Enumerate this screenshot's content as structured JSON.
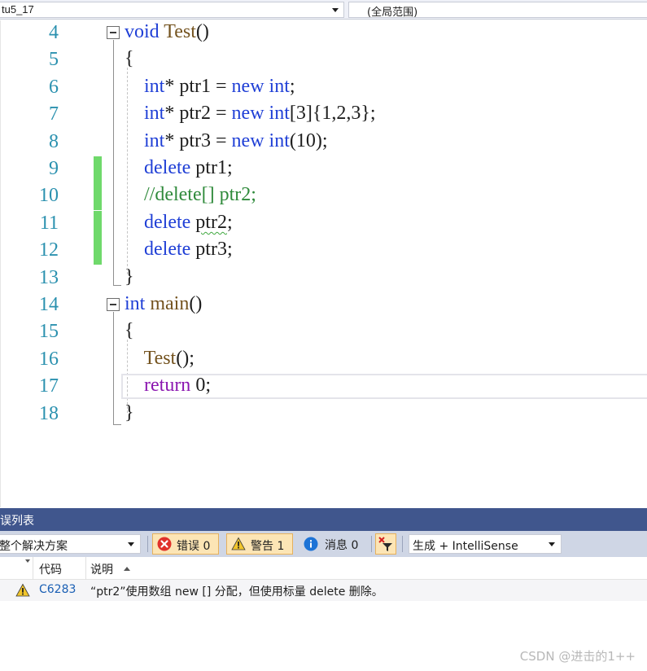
{
  "navbar": {
    "project_scope": "tu5_17",
    "member_scope": "(全局范围)"
  },
  "editor": {
    "lines": [
      {
        "num": "4",
        "tokens": [
          {
            "t": "void",
            "c": "kw"
          },
          {
            "t": " ",
            "c": "pl"
          },
          {
            "t": "Test",
            "c": "fn"
          },
          {
            "t": "()",
            "c": "pl"
          }
        ]
      },
      {
        "num": "5",
        "tokens": [
          {
            "t": "{",
            "c": "pl"
          }
        ]
      },
      {
        "num": "6",
        "tokens": [
          {
            "t": "    ",
            "c": "pl"
          },
          {
            "t": "int",
            "c": "kw"
          },
          {
            "t": "* ptr1 = ",
            "c": "pl"
          },
          {
            "t": "new",
            "c": "kw"
          },
          {
            "t": " ",
            "c": "pl"
          },
          {
            "t": "int",
            "c": "kw"
          },
          {
            "t": ";",
            "c": "pl"
          }
        ]
      },
      {
        "num": "7",
        "tokens": [
          {
            "t": "    ",
            "c": "pl"
          },
          {
            "t": "int",
            "c": "kw"
          },
          {
            "t": "* ptr2 = ",
            "c": "pl"
          },
          {
            "t": "new",
            "c": "kw"
          },
          {
            "t": " ",
            "c": "pl"
          },
          {
            "t": "int",
            "c": "kw"
          },
          {
            "t": "[3]{1,2,3};",
            "c": "pl"
          }
        ]
      },
      {
        "num": "8",
        "tokens": [
          {
            "t": "    ",
            "c": "pl"
          },
          {
            "t": "int",
            "c": "kw"
          },
          {
            "t": "* ptr3 = ",
            "c": "pl"
          },
          {
            "t": "new",
            "c": "kw"
          },
          {
            "t": " ",
            "c": "pl"
          },
          {
            "t": "int",
            "c": "kw"
          },
          {
            "t": "(10);",
            "c": "pl"
          }
        ]
      },
      {
        "num": "9",
        "tokens": [
          {
            "t": "    ",
            "c": "pl"
          },
          {
            "t": "delete",
            "c": "kw"
          },
          {
            "t": " ptr1;",
            "c": "pl"
          }
        ]
      },
      {
        "num": "10",
        "tokens": [
          {
            "t": "    ",
            "c": "pl"
          },
          {
            "t": "//delete[] ptr2;",
            "c": "cm"
          }
        ]
      },
      {
        "num": "11",
        "tokens": [
          {
            "t": "    ",
            "c": "pl"
          },
          {
            "t": "delete",
            "c": "kw"
          },
          {
            "t": " ",
            "c": "pl"
          },
          {
            "t": "ptr2",
            "c": "pl squig"
          },
          {
            "t": ";",
            "c": "pl"
          }
        ]
      },
      {
        "num": "12",
        "tokens": [
          {
            "t": "    ",
            "c": "pl"
          },
          {
            "t": "delete",
            "c": "kw"
          },
          {
            "t": " ptr3;",
            "c": "pl"
          }
        ]
      },
      {
        "num": "13",
        "tokens": [
          {
            "t": "}",
            "c": "pl"
          }
        ]
      },
      {
        "num": "14",
        "tokens": [
          {
            "t": "int",
            "c": "kw"
          },
          {
            "t": " ",
            "c": "pl"
          },
          {
            "t": "main",
            "c": "fn"
          },
          {
            "t": "()",
            "c": "pl"
          }
        ]
      },
      {
        "num": "15",
        "tokens": [
          {
            "t": "{",
            "c": "pl"
          }
        ]
      },
      {
        "num": "16",
        "tokens": [
          {
            "t": "    ",
            "c": "pl"
          },
          {
            "t": "Test",
            "c": "fn"
          },
          {
            "t": "();",
            "c": "pl"
          }
        ]
      },
      {
        "num": "17",
        "tokens": [
          {
            "t": "    ",
            "c": "pl"
          },
          {
            "t": "return",
            "c": "ret"
          },
          {
            "t": " 0;",
            "c": "pl"
          }
        ]
      },
      {
        "num": "18",
        "tokens": [
          {
            "t": "}",
            "c": "pl"
          }
        ]
      }
    ]
  },
  "error_list": {
    "title": "误列表",
    "scope_filter": "整个解决方案",
    "errors_label": "错误 0",
    "warnings_label": "警告 1",
    "messages_label": "消息 0",
    "source_filter": "生成 + IntelliSense",
    "columns": {
      "code": "代码",
      "description": "说明"
    },
    "rows": [
      {
        "code": "C6283",
        "description": "“ptr2”使用数组 new [] 分配，但使用标量 delete 删除。",
        "severity": "warning"
      }
    ]
  },
  "watermark": "CSDN @进击的1++",
  "colors": {
    "keyword": "#1f3fd6",
    "return_keyword": "#8b16b0",
    "function": "#74531f",
    "comment": "#2f8a3b",
    "line_number": "#2b91af",
    "change_marker": "#6fd96b",
    "panel_title_bg": "#40568d"
  }
}
